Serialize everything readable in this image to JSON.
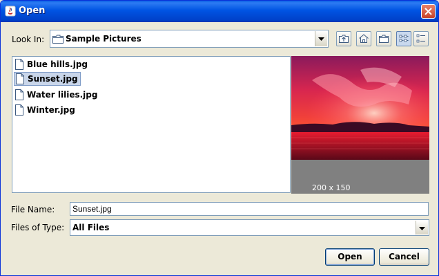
{
  "window": {
    "title": "Open",
    "accent_color": "#0054e3"
  },
  "toolbar": {
    "look_in_label": "Look In:",
    "look_in_value": "Sample Pictures",
    "buttons": [
      "up-one-level-icon",
      "home-icon",
      "new-folder-icon",
      "list-view-icon",
      "details-view-icon"
    ]
  },
  "files": [
    {
      "name": "Blue hills.jpg",
      "selected": false
    },
    {
      "name": "Sunset.jpg",
      "selected": true
    },
    {
      "name": "Water lilies.jpg",
      "selected": false
    },
    {
      "name": "Winter.jpg",
      "selected": false
    }
  ],
  "preview": {
    "dimensions": "200 x 150"
  },
  "form": {
    "file_name_label": "File Name:",
    "file_name_value": "Sunset.jpg",
    "files_of_type_label": "Files of Type:",
    "files_of_type_value": "All Files"
  },
  "actions": {
    "open_label": "Open",
    "cancel_label": "Cancel"
  }
}
